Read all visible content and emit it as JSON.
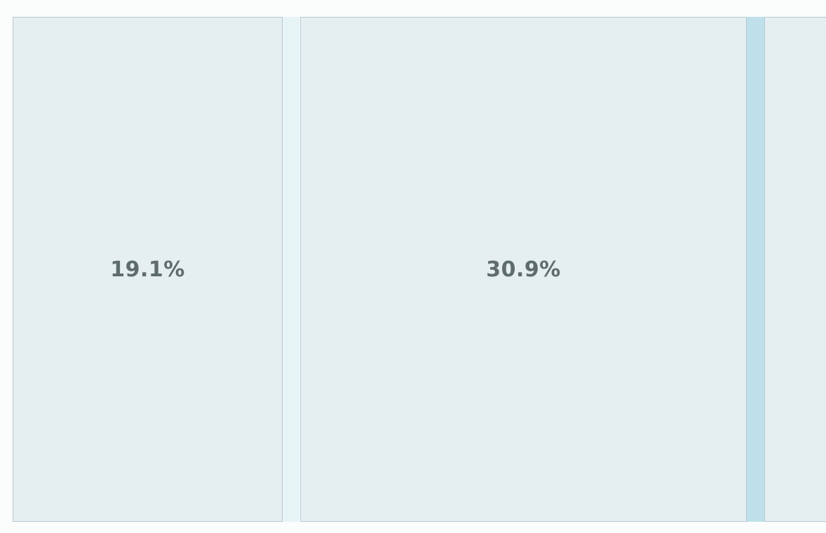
{
  "panes": [
    {
      "label": "19.1%",
      "size_percent": 19.1
    },
    {
      "label": "30.9%",
      "size_percent": 30.9
    },
    {
      "label": "",
      "size_percent": null
    }
  ],
  "colors": {
    "background": "#fbfcfc",
    "pane_fill": "#e5eef1",
    "pane_border": "#b9c9d0",
    "gutter_idle": "#e7f4f6",
    "gutter_active": "#bfe0ea",
    "label_text": "#5f6c6e"
  }
}
